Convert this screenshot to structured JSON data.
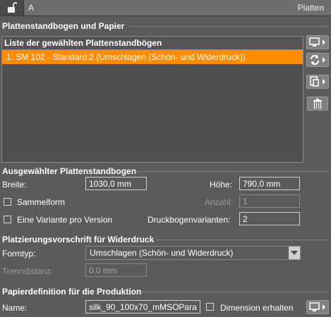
{
  "titlebar": {
    "left_label": "A",
    "right_label": "Platten"
  },
  "section_sheets": {
    "title": "Plattenstandbogen und Papier"
  },
  "list": {
    "header": "Liste der gewählten Plattenstandbögen",
    "items": [
      "1: SM 102 - Standard:2 (Umschlagen (Schön- und Widerdruck))"
    ]
  },
  "side_buttons": [
    "monitor-menu-icon",
    "refresh-menu-icon",
    "export-menu-icon",
    "trash-icon"
  ],
  "section_selected": {
    "title": "Ausgewählter Plattenstandbogen",
    "breite_label": "Breite:",
    "breite_value": "1030,0 mm",
    "hoehe_label": "Höhe:",
    "hoehe_value": "790,0 mm",
    "sammelform_label": "Sammelform",
    "anzahl_label": "Anzahl:",
    "anzahl_value": "1",
    "variante_label": "Eine Variante pro Version",
    "druckbogen_label": "Druckbogenvarianten:",
    "druckbogen_value": "2"
  },
  "section_placement": {
    "title": "Platzierungsvorschrift für Widerdruck",
    "formtyp_label": "Formtyp:",
    "formtyp_value": "Umschlagen (Schön- und Widerdruck)",
    "trenndistanz_label": "Trenndistanz:",
    "trenndistanz_value": "0,0 mm"
  },
  "section_paper": {
    "title": "Papierdefinition für die Produktion",
    "name_label": "Name:",
    "name_value": "silk_90_100x70_mMSOPara",
    "dimension_label": "Dimension erhalten"
  },
  "colors": {
    "accent": "#ff8c00",
    "background": "#5b5b5b"
  }
}
